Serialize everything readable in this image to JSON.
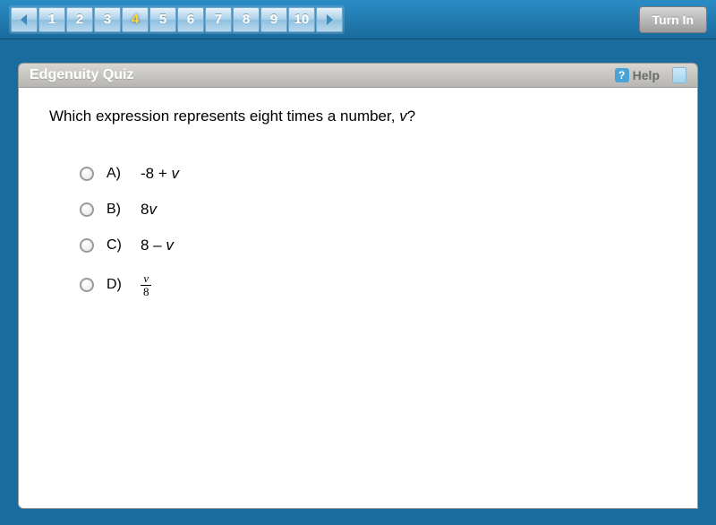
{
  "pager": {
    "prev_icon": "prev",
    "next_icon": "next",
    "numbers": [
      "1",
      "2",
      "3",
      "4",
      "5",
      "6",
      "7",
      "8",
      "9",
      "10"
    ],
    "active_index": 3
  },
  "turn_in_label": "Turn In",
  "header": {
    "title": "Edgenuity Quiz",
    "help_label": "Help"
  },
  "question": {
    "prefix": "Which expression represents eight times a number, ",
    "variable": "v",
    "suffix": "?"
  },
  "choices": [
    {
      "letter": "A)",
      "text_before": "-8 + ",
      "var": "v",
      "text_after": "",
      "type": "plain"
    },
    {
      "letter": "B)",
      "text_before": "8",
      "var": "v",
      "text_after": "",
      "type": "plain"
    },
    {
      "letter": "C)",
      "text_before": "8 – ",
      "var": "v",
      "text_after": "",
      "type": "plain"
    },
    {
      "letter": "D)",
      "numerator": "v",
      "denominator": "8",
      "type": "fraction"
    }
  ]
}
